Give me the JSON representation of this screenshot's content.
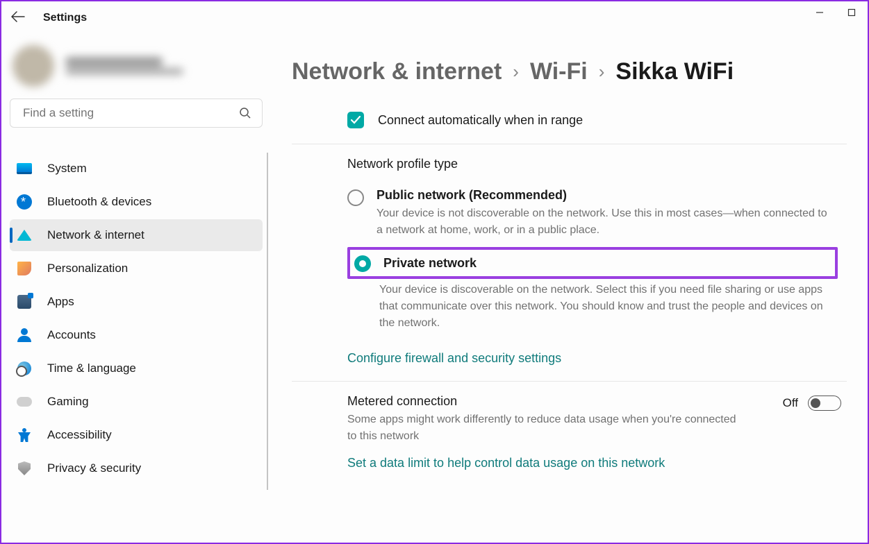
{
  "app_title": "Settings",
  "search": {
    "placeholder": "Find a setting"
  },
  "nav": {
    "items": [
      {
        "label": "System"
      },
      {
        "label": "Bluetooth & devices"
      },
      {
        "label": "Network & internet"
      },
      {
        "label": "Personalization"
      },
      {
        "label": "Apps"
      },
      {
        "label": "Accounts"
      },
      {
        "label": "Time & language"
      },
      {
        "label": "Gaming"
      },
      {
        "label": "Accessibility"
      },
      {
        "label": "Privacy & security"
      }
    ]
  },
  "breadcrumb": {
    "level1": "Network & internet",
    "level2": "Wi-Fi",
    "current": "Sikka WiFi"
  },
  "auto_connect": {
    "label": "Connect automatically when in range"
  },
  "profile": {
    "heading": "Network profile type",
    "public": {
      "title": "Public network (Recommended)",
      "desc": "Your device is not discoverable on the network. Use this in most cases—when connected to a network at home, work, or in a public place."
    },
    "private": {
      "title": "Private network",
      "desc": "Your device is discoverable on the network. Select this if you need file sharing or use apps that communicate over this network. You should know and trust the people and devices on the network."
    },
    "firewall_link": "Configure firewall and security settings"
  },
  "metered": {
    "title": "Metered connection",
    "desc": "Some apps might work differently to reduce data usage when you're connected to this network",
    "toggle_label": "Off",
    "limit_link": "Set a data limit to help control data usage on this network"
  }
}
